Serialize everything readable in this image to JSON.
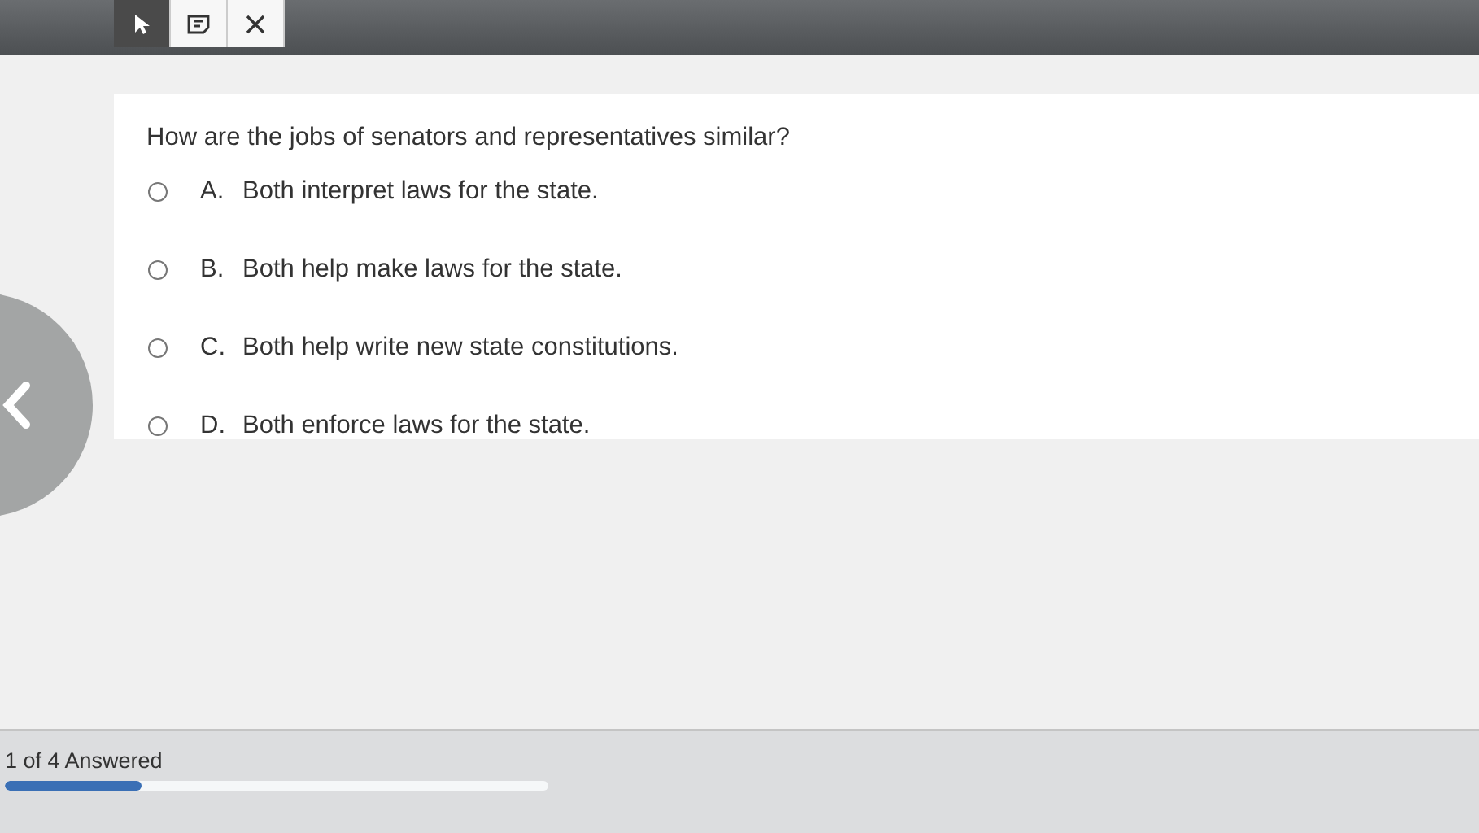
{
  "toolbar": {
    "tools": [
      {
        "kind": "pointer",
        "selected": true
      },
      {
        "kind": "note",
        "selected": false
      },
      {
        "kind": "eliminate",
        "selected": false
      }
    ]
  },
  "question": {
    "prompt": "How are the jobs of senators and representatives similar?",
    "choices": [
      {
        "letter": "A.",
        "text": "Both interpret laws for the state.",
        "selected": false
      },
      {
        "letter": "B.",
        "text": "Both help make laws for the state.",
        "selected": false
      },
      {
        "letter": "C.",
        "text": "Both help write new state constitutions.",
        "selected": false
      },
      {
        "letter": "D.",
        "text": "Both enforce laws for the state.",
        "selected": false
      }
    ]
  },
  "footer": {
    "status": "1 of 4 Answered",
    "progress": {
      "level": 0.25
    }
  }
}
